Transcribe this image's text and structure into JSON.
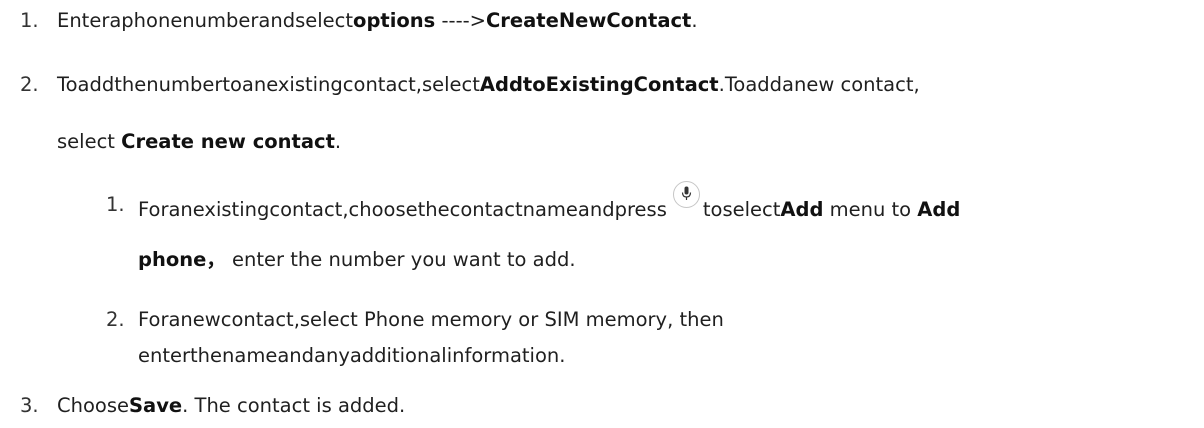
{
  "steps": [
    {
      "number": "1.",
      "text_a": "Enteraphonenumberandselect",
      "bold_a": "options",
      "text_b": " ---->",
      "bold_b": "CreateNewContact",
      "text_c": "."
    },
    {
      "number": "2.",
      "text_a": "Toaddthenumbertoanexistingcontact,select",
      "bold_a": "AddtoExistingContact",
      "text_b": ".Toaddanew contact,",
      "cont_text_a": "select ",
      "cont_bold_a": "Create new contact",
      "cont_text_b": "."
    },
    {
      "number": "3.",
      "text_a": "Choose",
      "bold_a": "Save",
      "text_b": ". The contact is added."
    }
  ],
  "substeps": [
    {
      "number": "1.",
      "text_a": "Foranexistingcontact,choosethecontactnameandpress",
      "icon": "microphone-icon",
      "text_b": "toselect",
      "bold_a": "Add",
      "text_c": " menu to ",
      "bold_b": "Add",
      "cont_bold_a": "phone，",
      "cont_text_a": " enter the number you want to add."
    },
    {
      "number": "2.",
      "text_a": "Foranewcontact,select Phone memory or SIM memory, then",
      "cont_text_a": "enterthenameandanyadditionalinformation."
    }
  ]
}
